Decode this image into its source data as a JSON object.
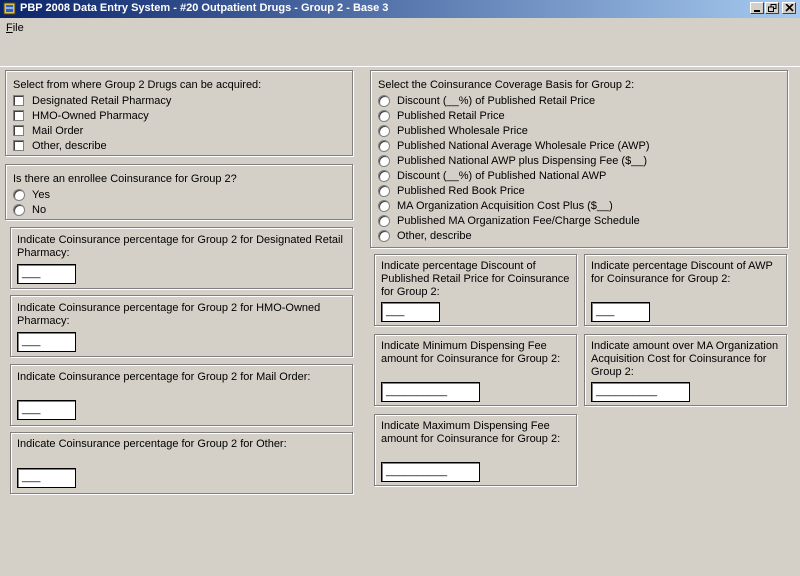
{
  "window": {
    "title": "PBP 2008 Data Entry System - #20 Outpatient Drugs - Group 2 - Base 3"
  },
  "menu": {
    "file_mnemonic": "F",
    "file_rest": "ile"
  },
  "acquire": {
    "label": "Select from where Group 2 Drugs can be acquired:",
    "options": [
      "Designated Retail Pharmacy",
      "HMO-Owned Pharmacy",
      "Mail Order",
      "Other, describe"
    ]
  },
  "enrollee": {
    "label": "Is there an enrollee Coinsurance for Group 2?",
    "options": [
      "Yes",
      "No"
    ]
  },
  "pct_retail": {
    "label": "Indicate Coinsurance percentage for Group 2 for Designated Retail Pharmacy:",
    "value": "___"
  },
  "pct_hmo": {
    "label": "Indicate Coinsurance percentage for Group 2 for HMO-Owned Pharmacy:",
    "value": "___"
  },
  "pct_mail": {
    "label": "Indicate Coinsurance percentage for Group 2 for Mail Order:",
    "value": "___"
  },
  "pct_other": {
    "label": "Indicate Coinsurance percentage for Group 2 for Other:",
    "value": "___"
  },
  "basis": {
    "label": "Select the Coinsurance Coverage Basis for Group 2:",
    "options": [
      "Discount (__%) of Published Retail Price",
      "Published Retail Price",
      "Published Wholesale Price",
      "Published National Average Wholesale Price (AWP)",
      "Published National AWP plus Dispensing Fee ($__)",
      "Discount (__%) of Published National AWP",
      "Published Red Book Price",
      "MA Organization Acquisition Cost Plus ($__)",
      "Published MA Organization Fee/Charge Schedule",
      "Other, describe"
    ]
  },
  "disc_retail": {
    "label": "Indicate percentage Discount of Published Retail Price for Coinsurance for Group 2:",
    "value": "___"
  },
  "disc_awp": {
    "label": "Indicate percentage Discount of AWP for Coinsurance for Group 2:",
    "value": "___"
  },
  "min_fee": {
    "label": "Indicate Minimum Dispensing Fee amount for Coinsurance for Group 2:",
    "value": "__________"
  },
  "over_ma": {
    "label": "Indicate amount over MA Organization Acquisition Cost for Coinsurance for Group 2:",
    "value": "__________"
  },
  "max_fee": {
    "label": "Indicate Maximum Dispensing Fee amount for Coinsurance for Group 2:",
    "value": "__________"
  }
}
